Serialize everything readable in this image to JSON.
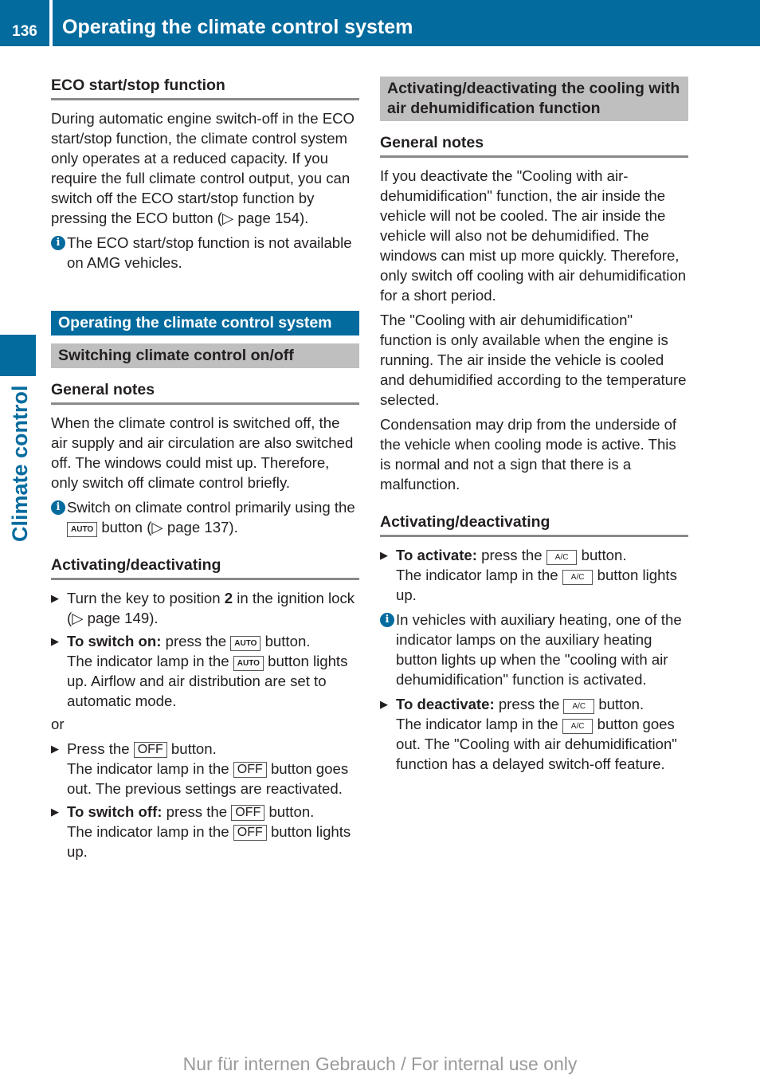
{
  "header": {
    "page_number": "136",
    "title": "Operating the climate control system"
  },
  "side_tab": {
    "label": "Climate control"
  },
  "left": {
    "eco_heading": "ECO start/stop function",
    "eco_text": "During automatic engine switch-off in the ECO start/stop function, the climate control system only operates at a reduced capacity. If you require the full climate control output, you can switch off the ECO start/stop function by pressing the ECO button (▷ page 154).",
    "eco_info": "The ECO start/stop function is not available on AMG vehicles.",
    "section_banner": "Operating the climate control system",
    "subsection_banner": "Switching climate control on/off",
    "general_heading": "General notes",
    "general_text": "When the climate control is switched off, the air supply and air circulation are also switched off. The windows could mist up. Therefore, only switch off climate control briefly.",
    "general_info_pre": "Switch on climate control primarily using the",
    "general_info_post": "button (▷ page 137).",
    "activ_heading": "Activating/deactivating",
    "step1_pre": "Turn the key to position ",
    "step1_bold": "2",
    "step1_post": " in the ignition lock (▷ page 149).",
    "step2_bold": "To switch on:",
    "step2_a": " press the ",
    "step2_b": " button.",
    "step2_c": "The indicator lamp in the ",
    "step2_d": " button lights up. Airflow and air distribution are set to automatic mode.",
    "or": "or",
    "step3_a": "Press the ",
    "step3_b": " button.",
    "step3_c": "The indicator lamp in the ",
    "step3_d": " button goes out. The previous settings are reactivated.",
    "step4_bold": "To switch off:",
    "step4_a": " press the ",
    "step4_b": " button.",
    "step4_c": "The indicator lamp in the ",
    "step4_d": " button lights up."
  },
  "buttons": {
    "auto": "AUTO",
    "off": "OFF",
    "ac": "A/C"
  },
  "right": {
    "banner": "Activating/deactivating the cooling with air dehumidification function",
    "general_heading": "General notes",
    "p1": "If you deactivate the \"Cooling with air-dehumidification\" function, the air inside the vehicle will not be cooled. The air inside the vehicle will also not be dehumidified. The windows can mist up more quickly. Therefore, only switch off cooling with air dehumidification for a short period.",
    "p2": "The \"Cooling with air dehumidification\" function is only available when the engine is running. The air inside the vehicle is cooled and dehumidified according to the temperature selected.",
    "p3": "Condensation may drip from the underside of the vehicle when cooling mode is active. This is normal and not a sign that there is a malfunction.",
    "activ_heading": "Activating/deactivating",
    "s1_bold": "To activate:",
    "s1_a": " press the ",
    "s1_b": " button.",
    "s1_c": "The indicator lamp in the ",
    "s1_d": " button lights up.",
    "info": "In vehicles with auxiliary heating, one of the indicator lamps on the auxiliary heating button lights up when the \"cooling with air dehumidification\" function is activated.",
    "s2_bold": "To deactivate:",
    "s2_a": " press the ",
    "s2_b": " button.",
    "s2_c": "The indicator lamp in the ",
    "s2_d": " button goes out. The \"Cooling with air dehumidification\" function has a delayed switch-off feature."
  },
  "footer": {
    "watermark": "Nur für internen Gebrauch / For internal use only"
  },
  "icons": {
    "info": "i",
    "arrow": "▶"
  }
}
